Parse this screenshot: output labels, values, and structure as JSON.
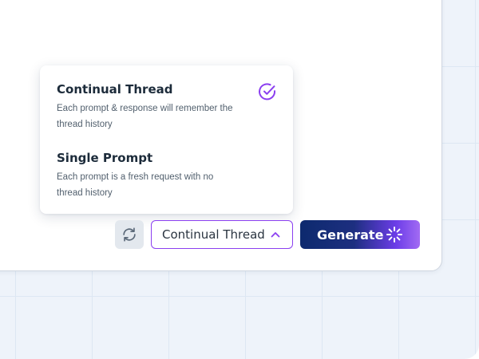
{
  "mode_menu": {
    "options": [
      {
        "title": "Continual Thread",
        "description": "Each prompt & response will remember the thread history",
        "selected": true
      },
      {
        "title": "Single Prompt",
        "description": "Each prompt is a fresh request with no thread history",
        "selected": false
      }
    ]
  },
  "toolbar": {
    "refresh_icon": "refresh-icon",
    "mode_select_value": "Continual Thread",
    "mode_select_icon": "chevron-up-icon",
    "generate_label": "Generate",
    "generate_icon": "spinner-icon"
  },
  "colors": {
    "accent": "#8b3ff0",
    "generate_gradient_start": "#0d2a6e",
    "generate_gradient_end": "#a26bf3",
    "text_dark": "#1c2b3a",
    "text_muted": "#52606e",
    "backdrop": "#eef3fa"
  }
}
